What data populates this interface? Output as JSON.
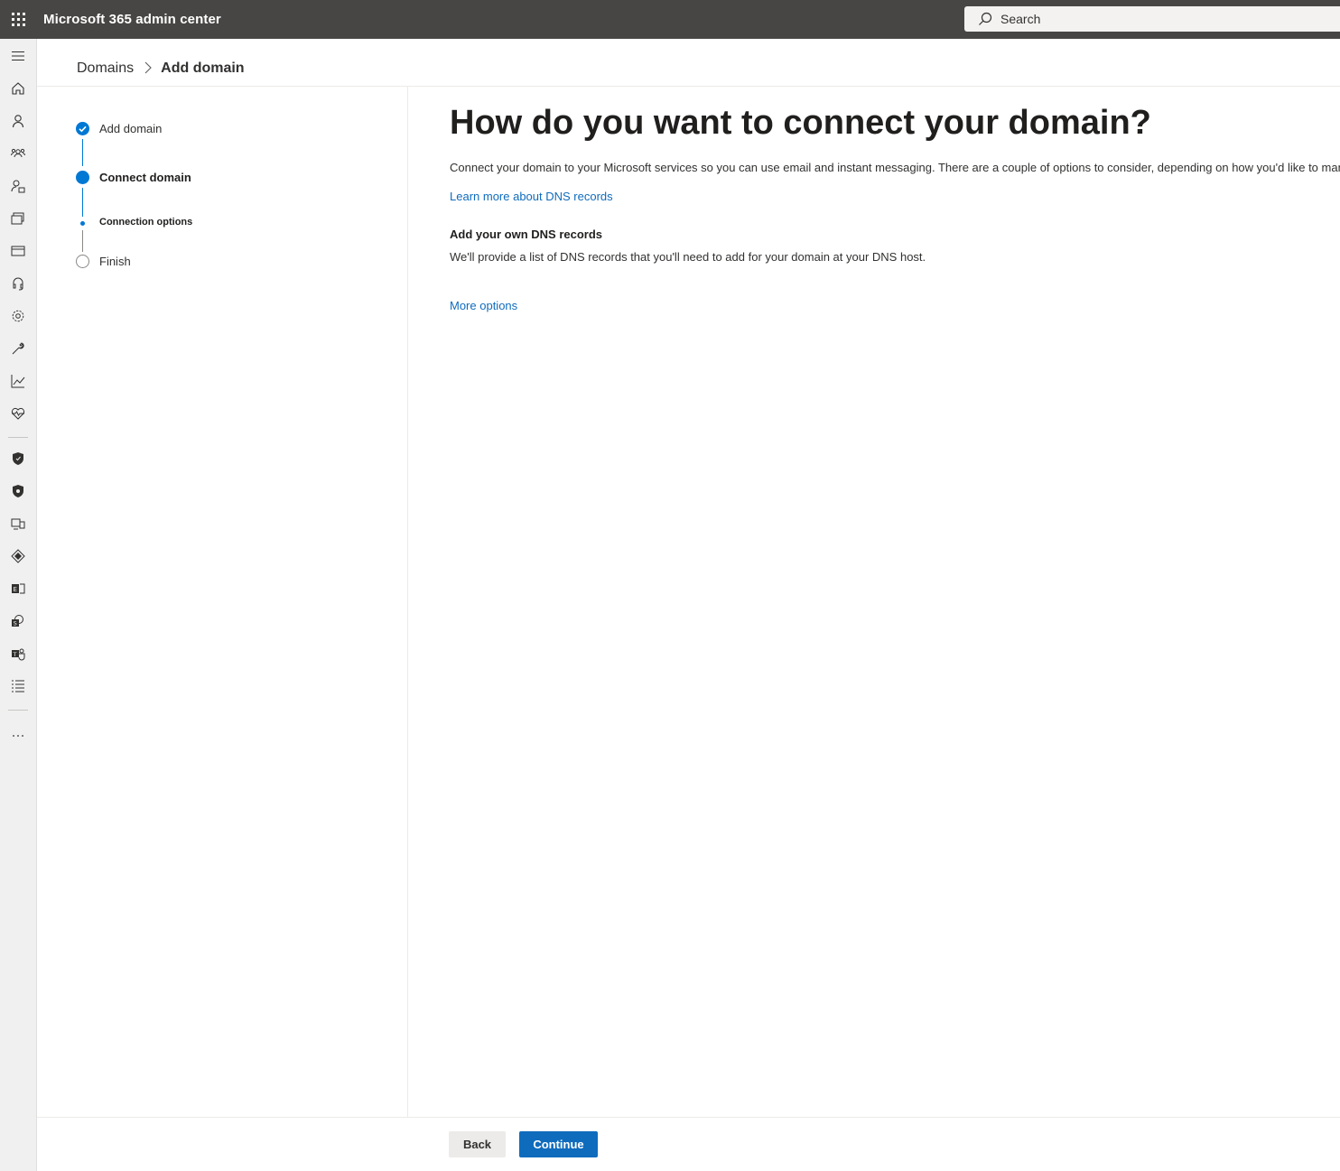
{
  "header": {
    "app_title": "Microsoft 365 admin center",
    "search_placeholder": "Search"
  },
  "nav": {
    "icons": [
      "menu-icon",
      "home-icon",
      "user-icon",
      "teams-groups-icon",
      "roles-icon",
      "resources-icon",
      "billing-icon",
      "support-icon",
      "settings-icon",
      "setup-icon",
      "reports-icon",
      "health-icon",
      "security-icon",
      "compliance-icon",
      "endpoint-manager-icon",
      "azure-ad-icon",
      "exchange-icon",
      "sharepoint-icon",
      "teams-icon",
      "all-admin-centers-icon",
      "more-icon"
    ]
  },
  "breadcrumb": {
    "parent": "Domains",
    "current": "Add domain"
  },
  "steps": {
    "step1": "Add domain",
    "step2": "Connect domain",
    "step2_sub": "Connection options",
    "step3": "Finish"
  },
  "main": {
    "title": "How do you want to connect your domain?",
    "intro": "Connect your domain to your Microsoft services so you can use email and instant messaging. There are a couple of options to consider, depending on how you'd like to manage c",
    "learn_link": "Learn more about DNS records",
    "option_title": "Add your own DNS records",
    "option_desc": "We'll provide a list of DNS records that you'll need to add for your domain at your DNS host.",
    "more_link": "More options"
  },
  "footer": {
    "back": "Back",
    "continue": "Continue"
  },
  "colors": {
    "topbar": "#484644",
    "accent": "#0078d4",
    "link": "#0f6cbd"
  }
}
